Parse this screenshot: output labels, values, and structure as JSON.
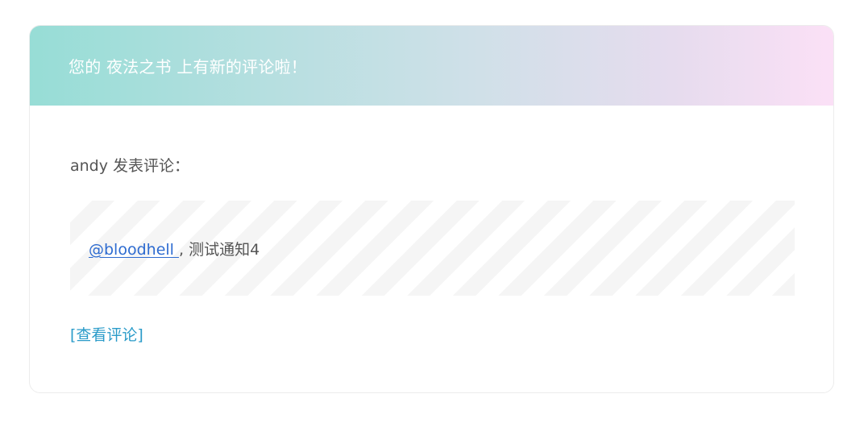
{
  "header": {
    "title": "您的 夜法之书 上有新的评论啦！"
  },
  "comment": {
    "author_line": "andy 发表评论：",
    "mention": "@bloodhell ",
    "text": ", 测试通知4"
  },
  "actions": {
    "view_comment": "[查看评论]"
  },
  "colors": {
    "header_gradient_start": "#97ddd6",
    "header_gradient_end": "#fbe0f6",
    "link": "#2d6bd0",
    "action_link": "#2a9bc9",
    "body_text": "#555555"
  }
}
